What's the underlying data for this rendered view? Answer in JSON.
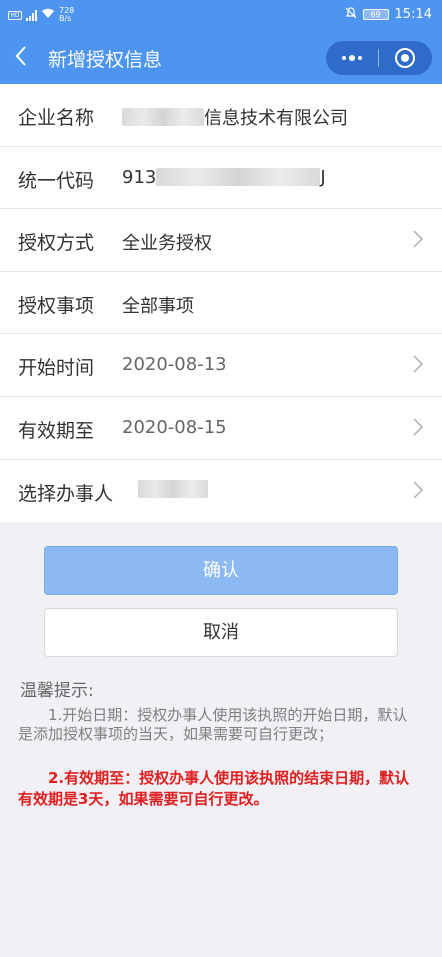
{
  "status_bar": {
    "net_speed_value": "728",
    "net_speed_unit": "B/s",
    "battery": "69",
    "time": "15:14"
  },
  "navbar": {
    "back_glyph": "〈",
    "title": "新增授权信息"
  },
  "form": {
    "rows": [
      {
        "label": "企业名称",
        "value_visible": "信息技术有限公司",
        "redacted": true,
        "has_arrow": false
      },
      {
        "label": "统一代码",
        "value_prefix": "913",
        "value_suffix": "J",
        "redacted": true,
        "has_arrow": false
      },
      {
        "label": "授权方式",
        "value": "全业务授权",
        "has_arrow": true
      },
      {
        "label": "授权事项",
        "value": "全部事项",
        "has_arrow": false
      },
      {
        "label": "开始时间",
        "value": "2020-08-13",
        "has_arrow": true
      },
      {
        "label": "有效期至",
        "value": "2020-08-15",
        "has_arrow": true
      },
      {
        "label": "选择办事人",
        "redacted": true,
        "has_arrow": true
      }
    ]
  },
  "buttons": {
    "confirm": "确认",
    "cancel": "取消"
  },
  "tips": {
    "title": "温馨提示:",
    "tip1": "1.开始日期：授权办事人使用该执照的开始日期，默认是添加授权事项的当天，如果需要可自行更改；",
    "tip2": "2.有效期至：授权办事人使用该执照的结束日期，默认有效期是3天，如果需要可自行更改。"
  },
  "colors": {
    "header_bg": "#4e95f2",
    "capsule_bg": "#2f6cc9",
    "confirm_bg": "#8db9f3",
    "tip_highlight": "#e02020",
    "page_bg": "#f0f0f5"
  },
  "icons": {
    "back": "chevron-left-icon",
    "more": "more-dots-icon",
    "close": "close-miniapp-icon",
    "row_arrow": "chevron-right-icon"
  }
}
